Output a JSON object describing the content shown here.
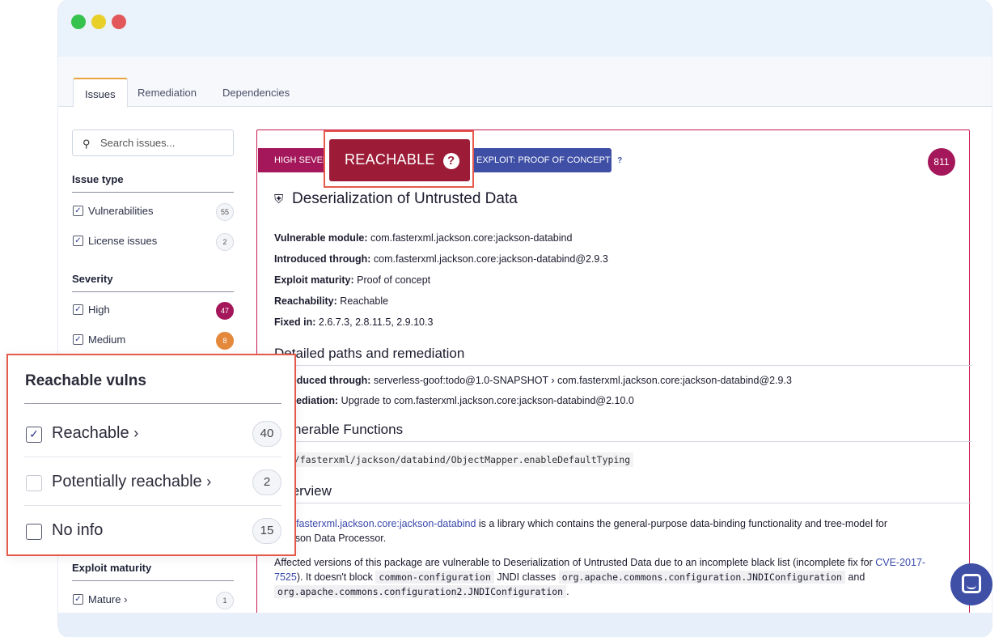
{
  "tabs": [
    "Issues",
    "Remediation",
    "Dependencies"
  ],
  "sidebar": {
    "search_placeholder": "Search issues...",
    "issue_type": {
      "heading": "Issue type",
      "items": [
        {
          "label": "Vulnerabilities",
          "count": "55",
          "checked": true
        },
        {
          "label": "License issues",
          "count": "2",
          "checked": true
        }
      ]
    },
    "severity": {
      "heading": "Severity",
      "items": [
        {
          "label": "High",
          "count": "47",
          "checked": true
        },
        {
          "label": "Medium",
          "count": "8",
          "checked": true
        }
      ]
    },
    "exploit_maturity": {
      "heading": "Exploit maturity",
      "items": [
        {
          "label": "Mature",
          "count": "1",
          "checked": true
        }
      ]
    }
  },
  "callout": {
    "title": "Reachable vulns",
    "items": [
      {
        "label": "Reachable",
        "count": "40",
        "checked": true
      },
      {
        "label": "Potentially reachable",
        "count": "2",
        "checked": false
      },
      {
        "label": "No info",
        "count": "15",
        "checked": false
      }
    ]
  },
  "issue": {
    "severity_badge": "HIGH SEVERITY",
    "reachable_badge": "REACHABLE",
    "exploit_badge": "EXPLOIT: PROOF OF CONCEPT",
    "score": "811",
    "title": "Deserialization of Untrusted Data",
    "fields": [
      {
        "label": "Vulnerable module:",
        "value": "com.fasterxml.jackson.core:jackson-databind"
      },
      {
        "label": "Introduced through:",
        "value": "com.fasterxml.jackson.core:jackson-databind@2.9.3"
      },
      {
        "label": "Exploit maturity:",
        "value": "Proof of concept"
      },
      {
        "label": "Reachability:",
        "value": "Reachable"
      },
      {
        "label": "Fixed in:",
        "value": "2.6.7.3, 2.8.11.5, 2.9.10.3"
      }
    ],
    "paths_heading": "Detailed paths and remediation",
    "path_intro_label": "Introduced through:",
    "path_intro_value": "serverless-goof:todo@1.0-SNAPSHOT › com.fasterxml.jackson.core:jackson-databind@2.9.3",
    "path_rem_label": "Remediation:",
    "path_rem_value": "Upgrade to com.fasterxml.jackson.core:jackson-databind@2.10.0",
    "functions_heading": "Vulnerable Functions",
    "function_code": "com/fasterxml/jackson/databind/ObjectMapper.enableDefaultTyping",
    "overview_heading": "Overview",
    "overview_link": "com.fasterxml.jackson.core:jackson-databind",
    "overview_text": " is a library which contains the general-purpose data-binding functionality and tree-model for",
    "overview_text2": "Jackson Data Processor.",
    "affected_text": "Affected versions of this package are vulnerable to Deserialization of Untrusted Data due to an incomplete black list (incomplete fix for ",
    "cve_link": "CVE-2017-7525",
    "affected_text2": "). It doesn't block ",
    "code1": "common-configuration",
    "affected_text3": " JNDI classes ",
    "code2": "org.apache.commons.configuration.JNDIConfiguration",
    "affected_text4": " and",
    "code3": "org.apache.commons.configuration2.JNDIConfiguration",
    "affected_text5": "."
  }
}
